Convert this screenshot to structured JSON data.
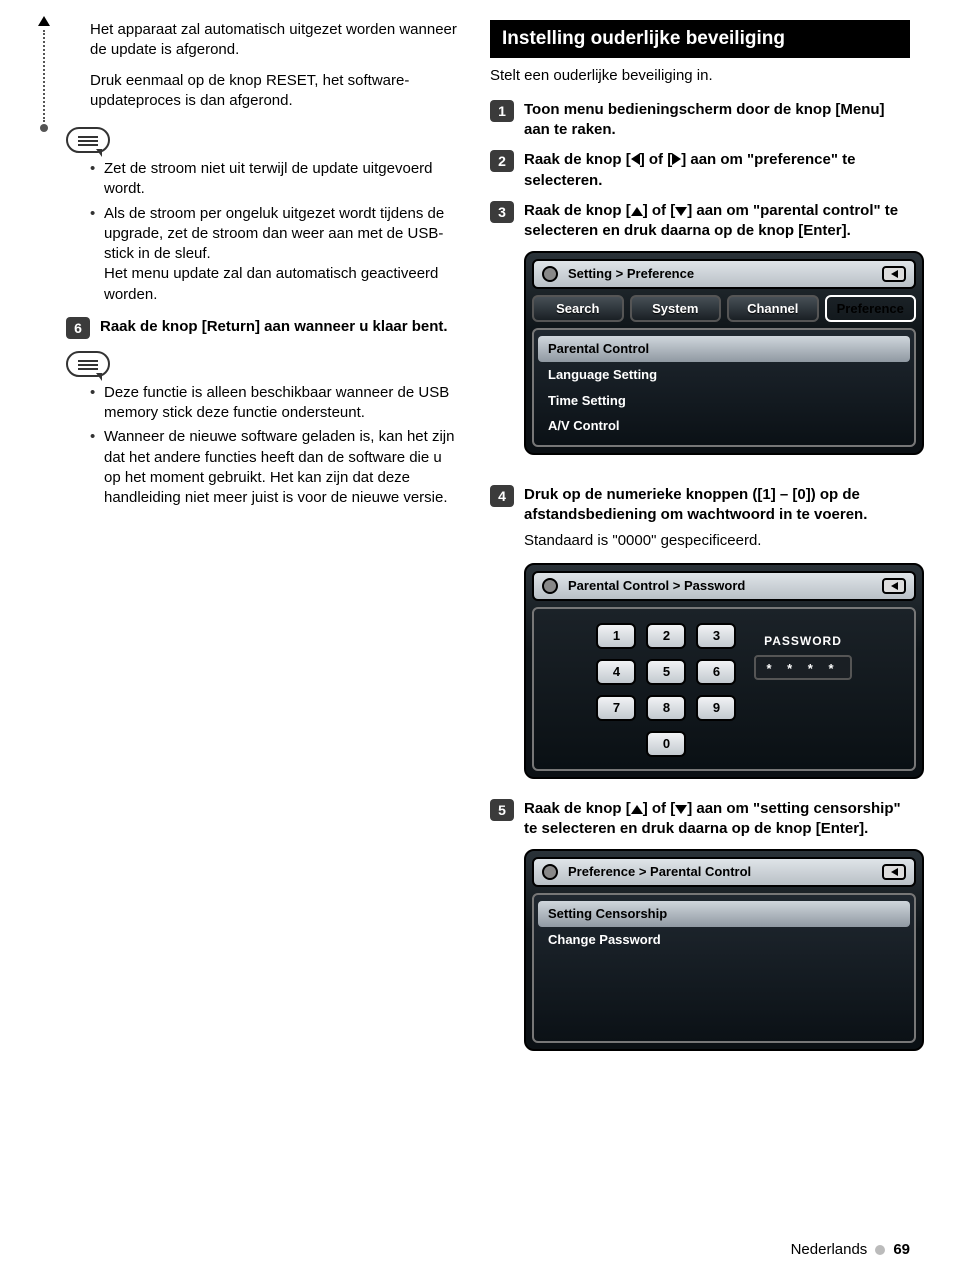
{
  "left": {
    "intro1": "Het apparaat zal automatisch uitgezet worden wanneer de update is afgerond.",
    "intro2": "Druk eenmaal op de knop RESET, het software-updateproces is dan afgerond.",
    "note1": [
      "Zet de stroom niet uit terwijl de update uitgevoerd wordt.",
      "Als de stroom per ongeluk uitgezet wordt tijdens de upgrade, zet de stroom dan weer aan met de USB-stick in de sleuf.\nHet menu update zal dan automatisch geactiveerd worden."
    ],
    "step6": {
      "num": "6",
      "text": "Raak de knop [Return] aan wanneer u klaar bent."
    },
    "note2": [
      "Deze functie is alleen beschikbaar wanneer de USB memory stick deze functie ondersteunt.",
      "Wanneer de nieuwe software geladen is, kan het zijn dat het andere functies heeft dan de software die u op het moment gebruikt. Het kan zijn dat deze handleiding niet meer juist is voor de nieuwe versie."
    ]
  },
  "right": {
    "section_title": "Instelling ouderlijke beveiliging",
    "section_sub": "Stelt een ouderlijke beveiliging in.",
    "step1": {
      "num": "1",
      "text": "Toon menu bedieningscherm door de knop [Menu] aan te raken."
    },
    "step2": {
      "num": "2",
      "pre": "Raak de knop [",
      "mid": "] of [",
      "post": "] aan om \"preference\" te selecteren."
    },
    "step3": {
      "num": "3",
      "pre": "Raak de knop [",
      "mid": "] of [",
      "post": "] aan om \"parental control\" te selecteren en druk daarna op de knop [Enter]."
    },
    "screen1": {
      "bread": "Setting  >  Preference",
      "tabs": [
        "Search",
        "System",
        "Channel",
        "Preference"
      ],
      "active_tab": 3,
      "items": [
        "Parental Control",
        "Language Setting",
        "Time Setting",
        "A/V Control"
      ],
      "selected": 0
    },
    "step4": {
      "num": "4",
      "text": "Druk op de numerieke knoppen ([1] – [0]) op de afstandsbediening om wachtwoord in te voeren.",
      "after": "Standaard is \"0000\" gespecificeerd."
    },
    "screen2": {
      "bread": "Parental Control > Password",
      "keys": [
        "1",
        "2",
        "3",
        "4",
        "5",
        "6",
        "7",
        "8",
        "9",
        "0"
      ],
      "pw_label": "PASSWORD",
      "pw_mask": "*  *  *  *"
    },
    "step5": {
      "num": "5",
      "pre": "Raak de knop [",
      "mid": "] of [",
      "post": "] aan om \"setting censorship\" te selecteren en druk daarna op de knop [Enter]."
    },
    "screen3": {
      "bread": "Preference > Parental Control",
      "items": [
        "Setting Censorship",
        "Change Password"
      ],
      "selected": 0
    }
  },
  "footer": {
    "lang": "Nederlands",
    "page": "69"
  }
}
